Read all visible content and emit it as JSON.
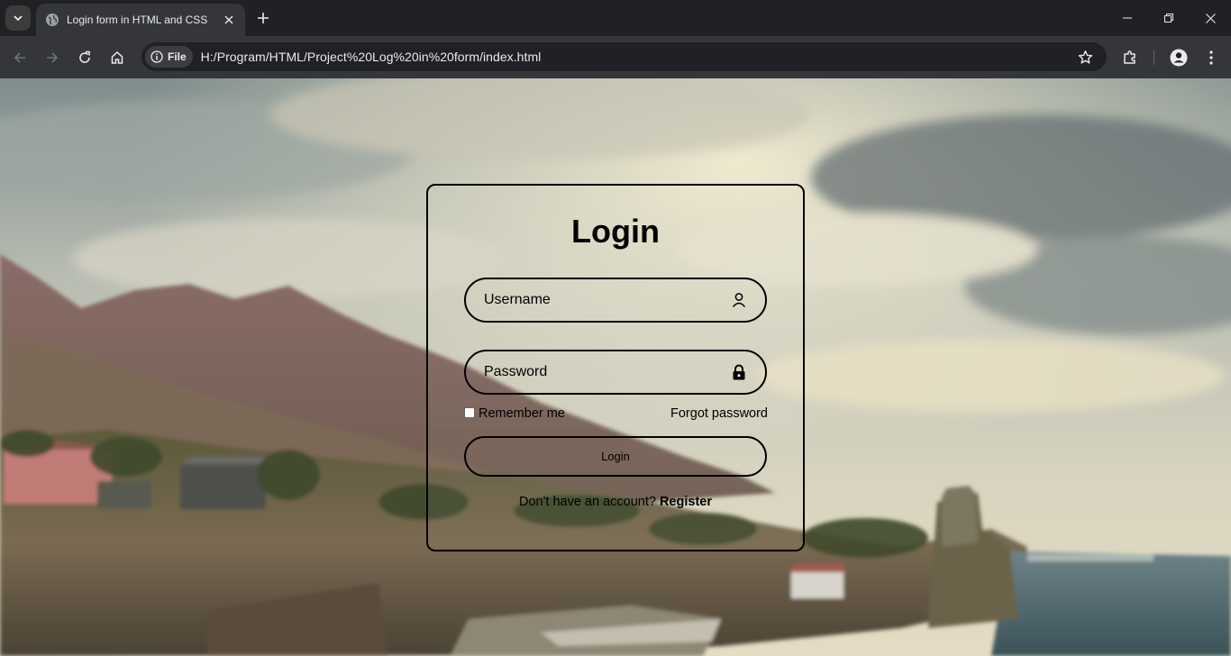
{
  "browser": {
    "tab_title": "Login form in HTML and CSS",
    "chip_label": "File",
    "url": "H:/Program/HTML/Project%20Log%20in%20form/index.html",
    "icons": [
      "tab-search-icon",
      "globe-icon",
      "close-icon",
      "plus-icon",
      "minimize-icon",
      "restore-icon",
      "close-window-icon",
      "back-arrow-icon",
      "forward-arrow-icon",
      "reload-icon",
      "home-icon",
      "info-icon",
      "star-icon",
      "extensions-icon",
      "profile-icon",
      "kebab-menu-icon"
    ],
    "colors": {
      "frame": "#202124",
      "toolbar": "#35363a",
      "omnibox": "#202124",
      "text": "#e8eaed"
    }
  },
  "login": {
    "title": "Login",
    "username_placeholder": "Username",
    "password_placeholder": "Password",
    "remember_label": "Remember me",
    "forgot_label": "Forgot password",
    "button_label": "Login",
    "register_prompt": "Don't have an account?",
    "register_link": "Register",
    "icons": [
      "user-icon",
      "lock-icon"
    ]
  }
}
